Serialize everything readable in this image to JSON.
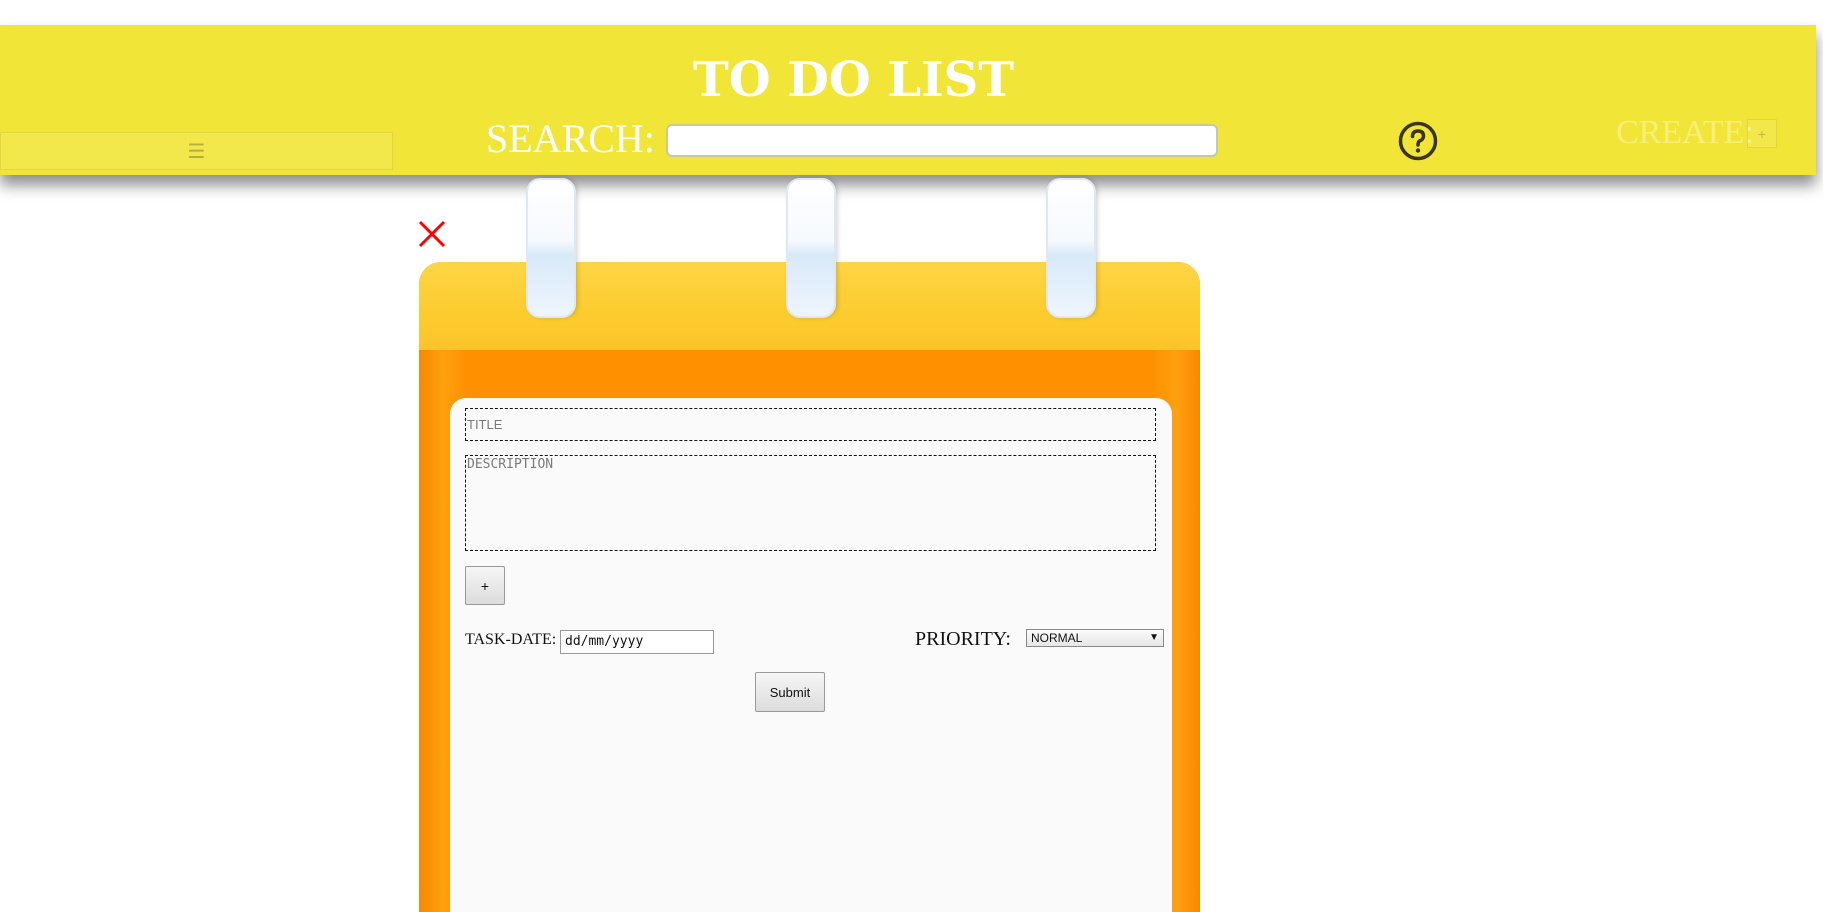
{
  "header": {
    "title": "TO DO LIST",
    "menu_icon": "hamburger-icon",
    "menu_glyph": "☰",
    "search_label": "SEARCH:",
    "search_value": "",
    "help_icon": "question-circle-icon",
    "create_label": "CREATE:",
    "create_button": "+"
  },
  "close_icon": "close-icon",
  "form": {
    "title_placeholder": "TITLE",
    "description_placeholder": "DESCRIPTION",
    "add_button": "+",
    "task_date_label": "TASK-DATE:",
    "task_date_value": "dd/mm/yyyy",
    "priority_label": "PRIORITY:",
    "priority_selected": "NORMAL",
    "submit_label": "Submit"
  },
  "colors": {
    "header_bg": "#f1e637",
    "close_red": "#ff0000",
    "notepad_orange": "#ff9100",
    "notepad_top": "#fccc2e"
  }
}
